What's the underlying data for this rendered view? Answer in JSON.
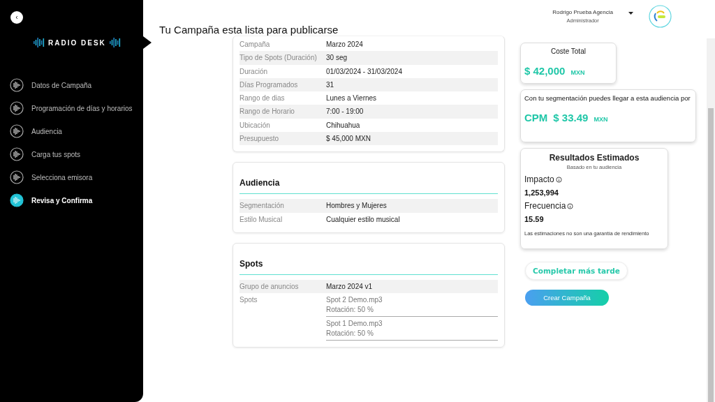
{
  "sidebar": {
    "logo": "RADIO DESK",
    "items": [
      {
        "label": "Datos de Campaña",
        "selected": false
      },
      {
        "label": "Programación de días y horarios",
        "selected": false
      },
      {
        "label": "Audiencia",
        "selected": false
      },
      {
        "label": "Carga tus spots",
        "selected": false
      },
      {
        "label": "Selecciona emisora",
        "selected": false
      },
      {
        "label": "Revisa y Confirma",
        "selected": true
      }
    ]
  },
  "user": {
    "name": "Rodrigo Prueba Agencia",
    "role": "Administrador"
  },
  "title": "Tu Campaña esta lista para publicarse",
  "sections": [
    {
      "rows": [
        {
          "label": "Campaña",
          "value": "Marzo 2024"
        },
        {
          "label": "Tipo de Spots (Duración)",
          "value": "30 seg"
        },
        {
          "label": "Duración",
          "value": "01/03/2024 - 31/03/2024"
        },
        {
          "label": "Días Programados",
          "value": "31"
        },
        {
          "label": "Rango de dias",
          "value": "Lunes a Viernes"
        },
        {
          "label": "Rango de Horario",
          "value": "7:00 - 19:00"
        },
        {
          "label": "Ubicación",
          "value": "Chihuahua"
        },
        {
          "label": "Presupuesto",
          "value": "$ 45,000 MXN"
        }
      ]
    },
    {
      "heading": "Audiencia",
      "rows": [
        {
          "label": "Segmentación",
          "value": "Hombres y Mujeres"
        },
        {
          "label": "Estilo Musical",
          "value": "Cualquier estilo musical"
        }
      ]
    },
    {
      "heading": "Spots",
      "rows": [
        {
          "label": "Grupo de anuncios",
          "value": "Marzo 2024 v1"
        }
      ],
      "spots_label": "Spots",
      "spots": [
        {
          "name": "Spot 2 Demo.mp3",
          "rotation": "Rotación: 50 %"
        },
        {
          "name": "Spot 1 Demo.mp3",
          "rotation": "Rotación: 50 %"
        }
      ]
    }
  ],
  "cost": {
    "title": "Coste Total",
    "amount": "$ 42,000",
    "currency": "MXN"
  },
  "cpm": {
    "text": "Con tu segmentación puedes llegar a esta audiencia por",
    "label": "CPM",
    "amount": "$ 33.49",
    "currency": "MXN"
  },
  "results": {
    "title": "Resultados Estimados",
    "subtitle": "Basado en tu audiencia",
    "metrics": [
      {
        "label": "Impacto",
        "value": "1,253,994"
      },
      {
        "label": "Frecuencia",
        "value": "15.59"
      }
    ],
    "note": "Las estimaciones no son una garantía de rendimiento"
  },
  "buttons": {
    "later": "Completar más tarde",
    "create": "Crear Campaña"
  }
}
